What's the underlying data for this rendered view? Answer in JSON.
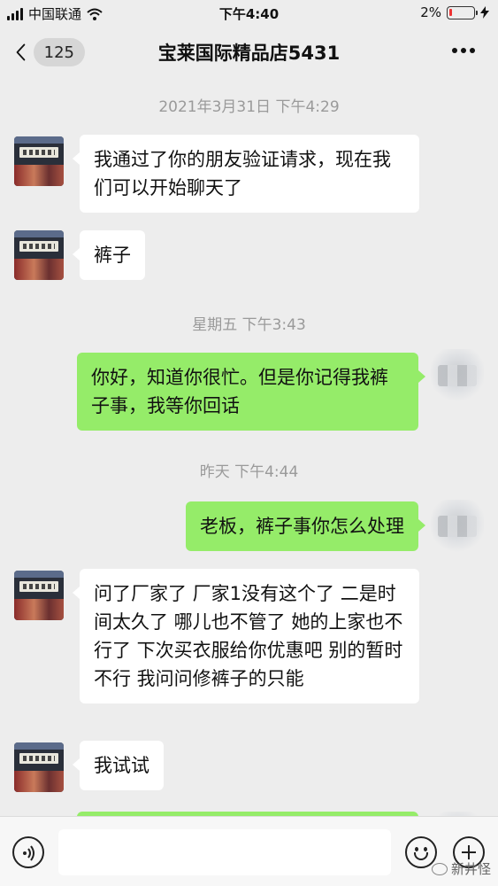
{
  "status_bar": {
    "carrier": "中国联通",
    "time": "下午4:40",
    "battery": "2%"
  },
  "header": {
    "unread_count": "125",
    "title": "宝莱国际精品店5431"
  },
  "timestamps": [
    "2021年3月31日 下午4:29",
    "星期五 下午3:43",
    "昨天 下午4:44"
  ],
  "messages": [
    {
      "side": "left",
      "text": "我通过了你的朋友验证请求，现在我们可以开始聊天了"
    },
    {
      "side": "left",
      "text": "裤子"
    },
    {
      "side": "right",
      "text": "你好，知道你很忙。但是你记得我裤子事，我等你回话"
    },
    {
      "side": "right",
      "text": "老板，裤子事你怎么处理"
    },
    {
      "side": "left",
      "text": "问了厂家了 厂家1没有这个了 二是时间太久了 哪儿也不管了 她的上家也不行了 下次买衣服给你优惠吧 别的暂时不行 我问问修裤子的只能"
    },
    {
      "side": "left",
      "text": "我试试"
    }
  ],
  "watermark": "新井怪",
  "colors": {
    "background": "#ededed",
    "sent_bubble": "#95ec69",
    "received_bubble": "#ffffff"
  }
}
